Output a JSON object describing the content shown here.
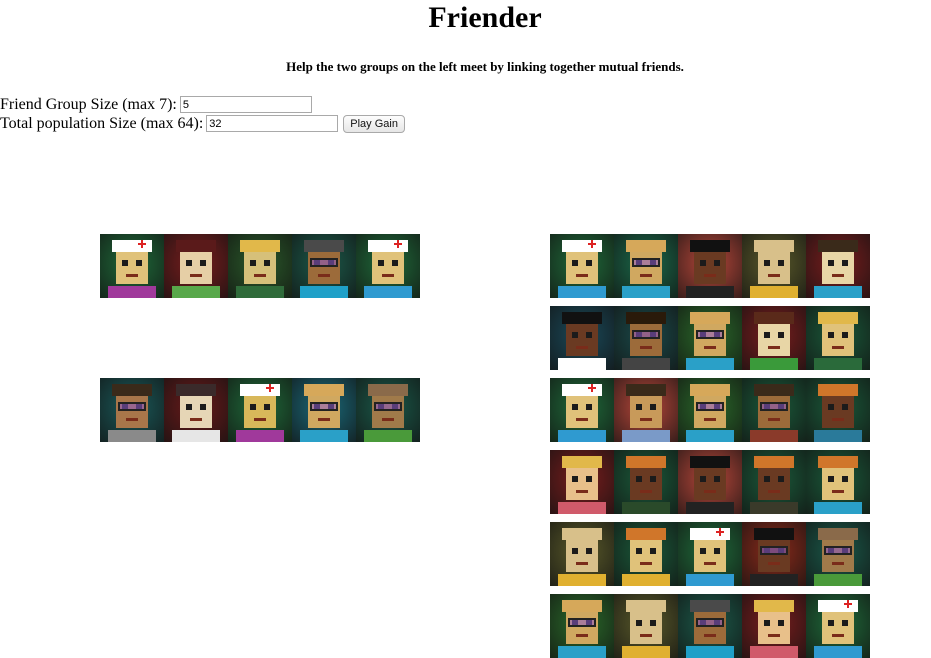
{
  "header": {
    "title": "Friender",
    "instructions": "Help the two groups on the left meet by linking together mutual friends."
  },
  "form": {
    "group_size_label": "Friend Group Size (max 7):",
    "group_size_value": "5",
    "population_label": "Total population Size (max 64):",
    "population_value": "32",
    "play_button_label": "Play Gain"
  },
  "group_a": [
    {
      "name": "nurse",
      "bg": "#1f6b3a",
      "skin": "#e0c27a",
      "hair": "#ffffff",
      "shirt": "#a0399b",
      "hat": true
    },
    {
      "name": "brunette",
      "bg": "#7a1d1d",
      "skin": "#e6cfa6",
      "hair": "#5a1a1a",
      "shirt": "#58a84a"
    },
    {
      "name": "blonde",
      "bg": "#2a5a2a",
      "skin": "#d6c07a",
      "hair": "#e1b84a",
      "shirt": "#2f6b3a"
    },
    {
      "name": "shades",
      "bg": "#1b5a4a",
      "skin": "#9c6b3a",
      "hair": "#4a4a4a",
      "shirt": "#1fa0c8",
      "glasses": true
    },
    {
      "name": "nurse-2",
      "bg": "#1f6b3a",
      "skin": "#e0c27a",
      "hair": "#ffffff",
      "shirt": "#2f9ad0",
      "hat": true
    }
  ],
  "group_b": [
    {
      "name": "glasses-girl",
      "bg": "#1a5a5a",
      "skin": "#a8764a",
      "hair": "#3a2a1a",
      "shirt": "#8a8a8a",
      "glasses": true
    },
    {
      "name": "goatee",
      "bg": "#6a1a1a",
      "skin": "#e6d6b6",
      "hair": "#3a2a2a",
      "shirt": "#e6e6e6"
    },
    {
      "name": "nurse-3",
      "bg": "#1f6b3a",
      "skin": "#d8b85a",
      "hair": "#ffffff",
      "shirt": "#a0399b",
      "hat": true
    },
    {
      "name": "purple-specs",
      "bg": "#1a6a7a",
      "skin": "#d0a860",
      "hair": "#d6a85a",
      "shirt": "#2aa0c8",
      "glasses": true
    },
    {
      "name": "bald-specs",
      "bg": "#1a5a4a",
      "skin": "#a07a4a",
      "hair": "#8a6a4a",
      "shirt": "#4a9a3a",
      "glasses": true
    }
  ],
  "population": [
    [
      {
        "name": "p1",
        "bg": "#1f6b3a",
        "skin": "#e0c27a",
        "hair": "#ffffff",
        "shirt": "#2f9ad0",
        "hat": true
      },
      {
        "name": "p2",
        "bg": "#1a6a4a",
        "skin": "#d0a860",
        "hair": "#d6a85a",
        "shirt": "#2aa0c8",
        "glasses": true
      },
      {
        "name": "p3",
        "bg": "#b8473a",
        "skin": "#6a3a22",
        "hair": "#111111",
        "shirt": "#222222"
      },
      {
        "name": "p4",
        "bg": "#5a5a2a",
        "skin": "#d8c08a",
        "hair": "#d8c08a",
        "shirt": "#e0b030"
      },
      {
        "name": "p5",
        "bg": "#7a1d1d",
        "skin": "#e8d6a6",
        "hair": "#3a2a1a",
        "shirt": "#2aa0c8"
      }
    ],
    [
      {
        "name": "p6",
        "bg": "#1a4a5a",
        "skin": "#6a3a22",
        "hair": "#111111",
        "shirt": "#ffffff"
      },
      {
        "name": "p7",
        "bg": "#1a4a4a",
        "skin": "#9c6b3a",
        "hair": "#2a1a0a",
        "shirt": "#444444",
        "glasses": true
      },
      {
        "name": "p8",
        "bg": "#2a6a2a",
        "skin": "#d0a860",
        "hair": "#d6a85a",
        "shirt": "#2aa0c8",
        "glasses": true
      },
      {
        "name": "p9",
        "bg": "#7a1d1d",
        "skin": "#e8d6a6",
        "hair": "#5a2a1a",
        "shirt": "#3a9a3a"
      },
      {
        "name": "p10",
        "bg": "#1a5a3a",
        "skin": "#e0c27a",
        "hair": "#e1b84a",
        "shirt": "#2a6a3a"
      }
    ],
    [
      {
        "name": "p11",
        "bg": "#1f6b3a",
        "skin": "#e0c27a",
        "hair": "#ffffff",
        "shirt": "#2f9ad0",
        "hat": true
      },
      {
        "name": "p12",
        "bg": "#b8473a",
        "skin": "#c89a5a",
        "hair": "#3a2a1a",
        "shirt": "#7a9ac8"
      },
      {
        "name": "p13",
        "bg": "#2a6a2a",
        "skin": "#d0a860",
        "hair": "#d6a85a",
        "shirt": "#2aa0c8",
        "glasses": true
      },
      {
        "name": "p14",
        "bg": "#1a5a3a",
        "skin": "#9c6b3a",
        "hair": "#3a2a1a",
        "shirt": "#8a3a2a",
        "glasses": true
      },
      {
        "name": "p15",
        "bg": "#1a5a3a",
        "skin": "#6a3a22",
        "hair": "#d0762a",
        "shirt": "#2a7a9a"
      }
    ],
    [
      {
        "name": "p16",
        "bg": "#7a1d1d",
        "skin": "#e8c08a",
        "hair": "#e1b84a",
        "shirt": "#d05a6a"
      },
      {
        "name": "p17",
        "bg": "#1a5a3a",
        "skin": "#6a3a22",
        "hair": "#d0762a",
        "shirt": "#2a4a2a"
      },
      {
        "name": "p18",
        "bg": "#b8473a",
        "skin": "#6a3a22",
        "hair": "#111111",
        "shirt": "#222222"
      },
      {
        "name": "p19",
        "bg": "#1a5a3a",
        "skin": "#6a3a22",
        "hair": "#d0762a",
        "shirt": "#3a3a2a"
      },
      {
        "name": "p20",
        "bg": "#1a5a3a",
        "skin": "#e0c27a",
        "hair": "#d0762a",
        "shirt": "#2aa0c8"
      }
    ],
    [
      {
        "name": "p21",
        "bg": "#5a5a2a",
        "skin": "#d8c08a",
        "hair": "#d8c08a",
        "shirt": "#e0b030"
      },
      {
        "name": "p22",
        "bg": "#1a5a3a",
        "skin": "#e0c27a",
        "hair": "#d0762a",
        "shirt": "#e0b030"
      },
      {
        "name": "p23",
        "bg": "#1f6b3a",
        "skin": "#e0c27a",
        "hair": "#ffffff",
        "shirt": "#2f9ad0",
        "hat": true
      },
      {
        "name": "p24",
        "bg": "#8a2a1a",
        "skin": "#6a3a22",
        "hair": "#111111",
        "shirt": "#222222",
        "glasses": true
      },
      {
        "name": "p25",
        "bg": "#1a5a4a",
        "skin": "#a07a4a",
        "hair": "#8a6a4a",
        "shirt": "#4a9a3a",
        "glasses": true
      }
    ],
    [
      {
        "name": "p26",
        "bg": "#2a6a2a",
        "skin": "#d0a860",
        "hair": "#d6a85a",
        "shirt": "#2aa0c8",
        "glasses": true
      },
      {
        "name": "p27",
        "bg": "#5a5a2a",
        "skin": "#d8c08a",
        "hair": "#d8c08a",
        "shirt": "#e0b030"
      },
      {
        "name": "p28",
        "bg": "#1b5a4a",
        "skin": "#9c6b3a",
        "hair": "#4a4a4a",
        "shirt": "#1fa0c8",
        "glasses": true
      },
      {
        "name": "p29",
        "bg": "#7a1d1d",
        "skin": "#e8c08a",
        "hair": "#e1b84a",
        "shirt": "#d05a6a"
      },
      {
        "name": "p30",
        "bg": "#1f6b3a",
        "skin": "#e0c27a",
        "hair": "#ffffff",
        "shirt": "#2f9ad0",
        "hat": true
      }
    ]
  ]
}
